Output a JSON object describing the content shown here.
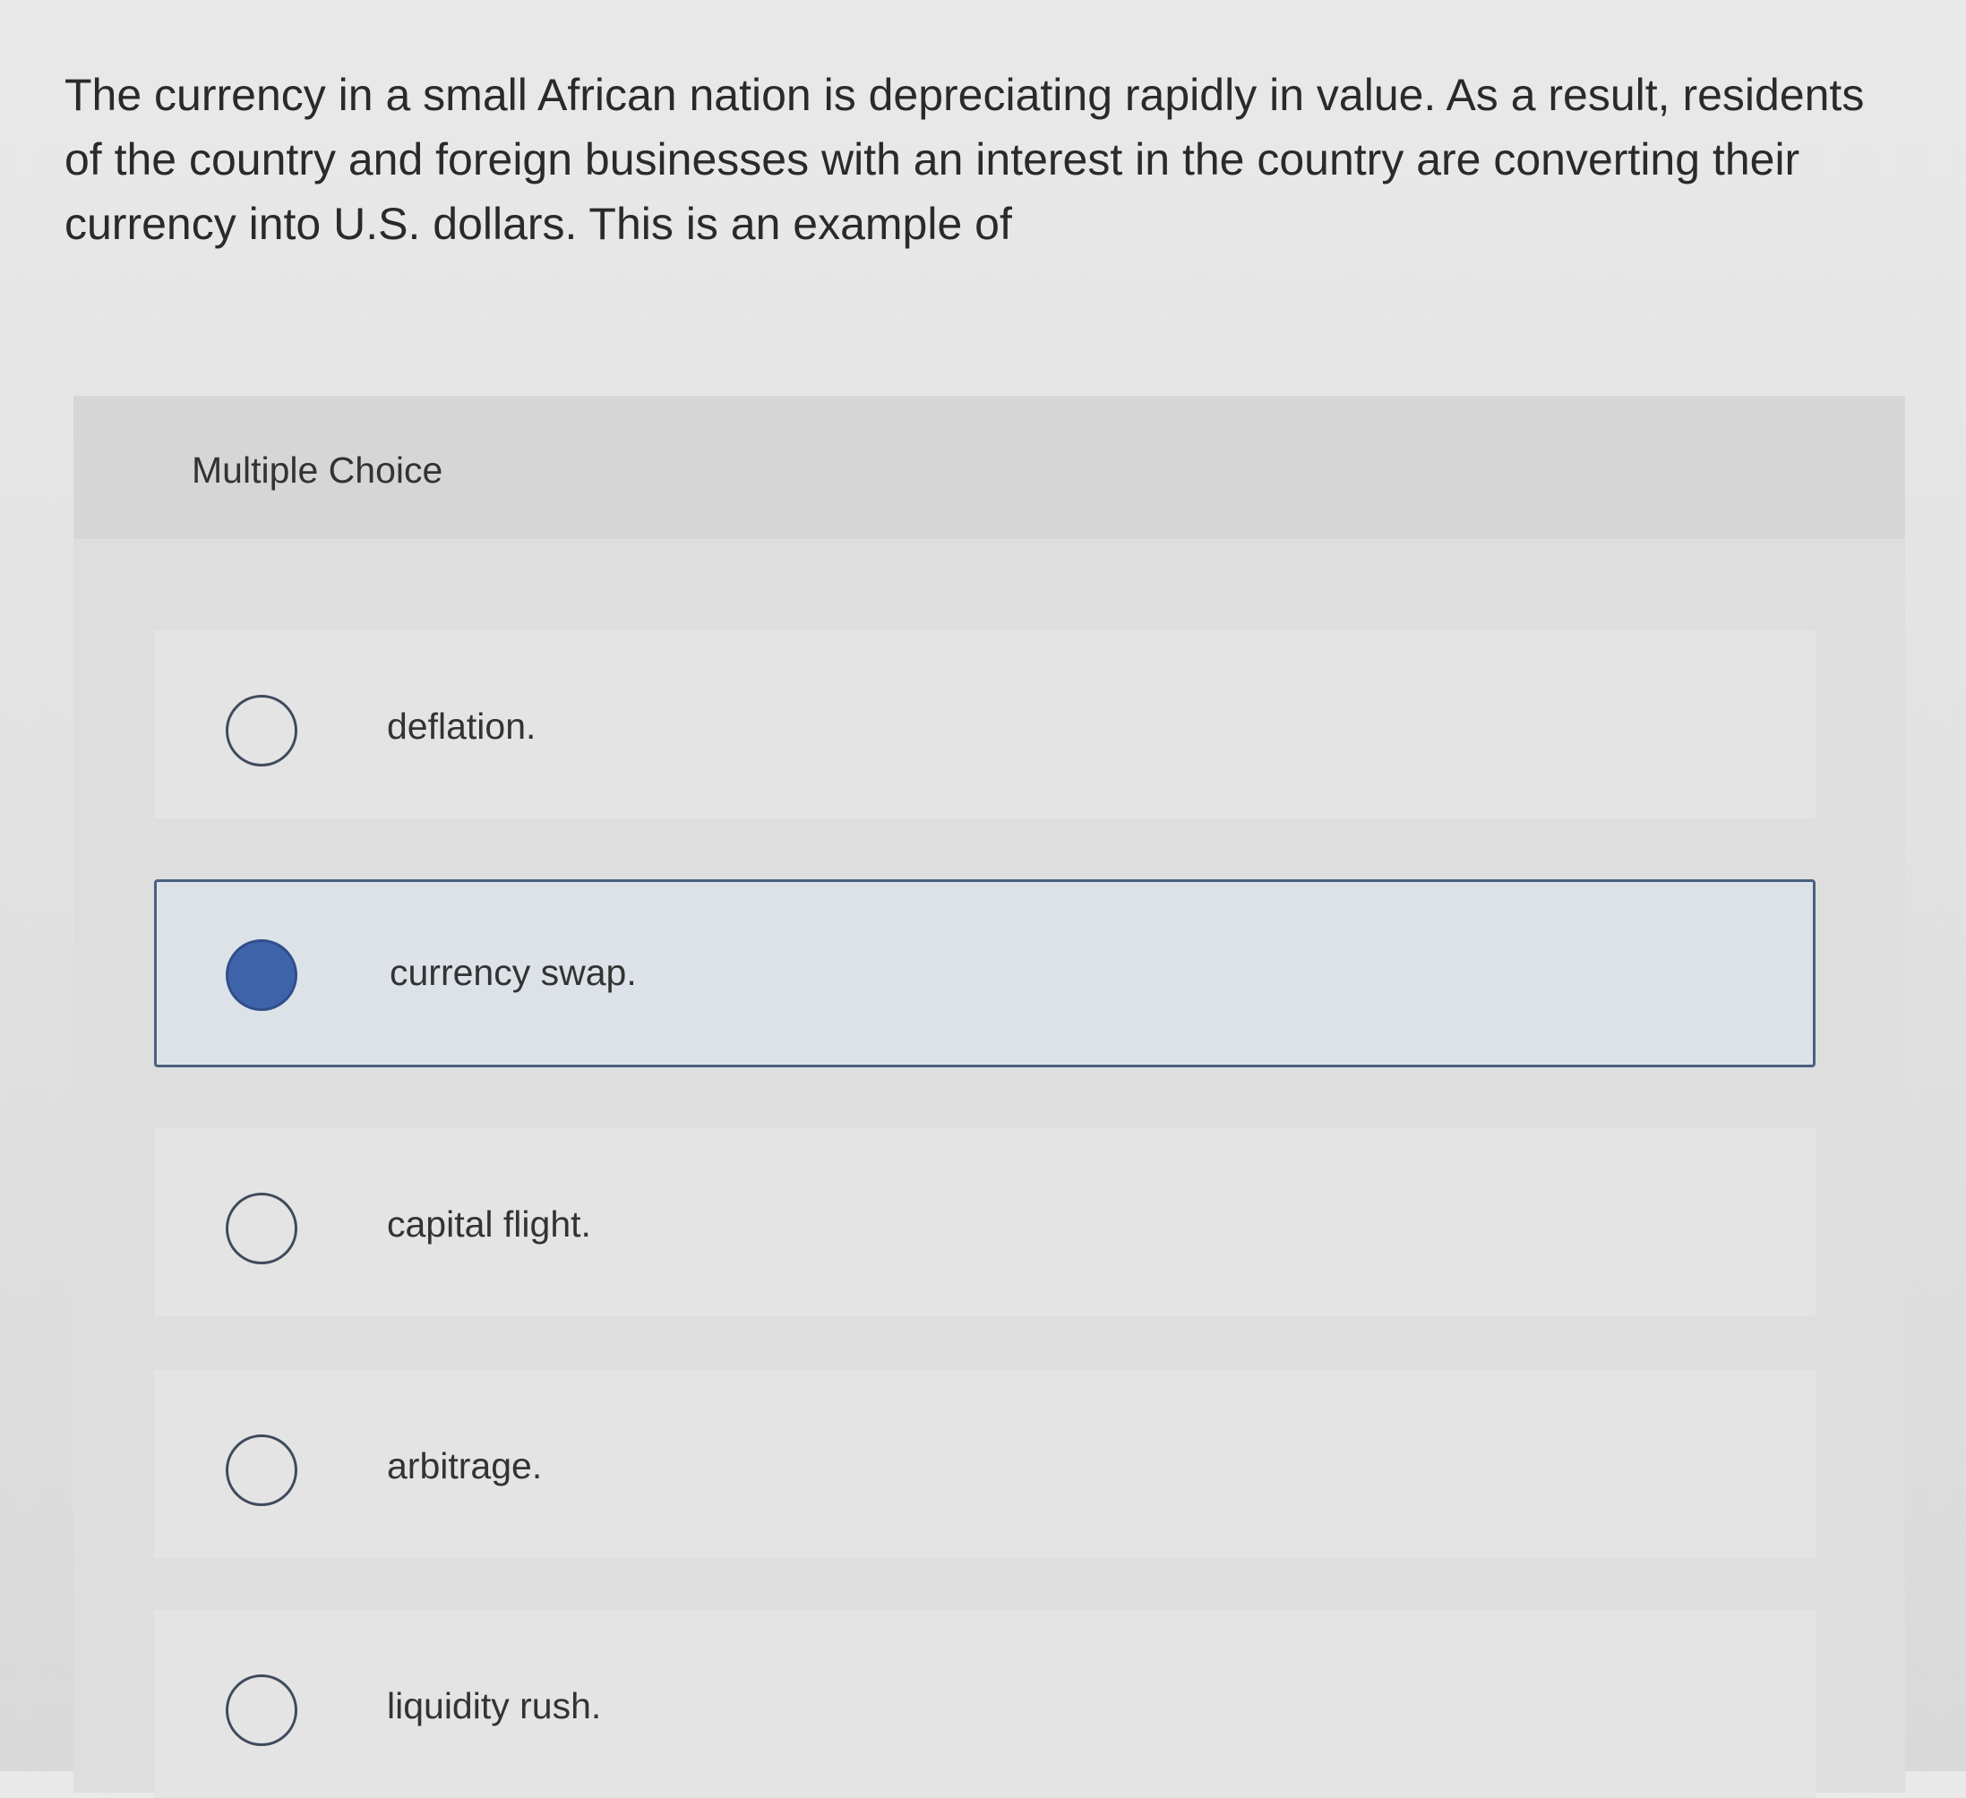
{
  "question": {
    "text": "The currency in a small African nation is depreciating rapidly in value. As a result, residents of the country and foreign businesses with an interest in the country are converting their currency into U.S. dollars. This is an example of"
  },
  "multiple_choice": {
    "title": "Multiple Choice",
    "options": [
      {
        "label": "deflation.",
        "selected": false
      },
      {
        "label": "currency swap.",
        "selected": true
      },
      {
        "label": "capital flight.",
        "selected": false
      },
      {
        "label": "arbitrage.",
        "selected": false
      },
      {
        "label": "liquidity rush.",
        "selected": false
      }
    ]
  },
  "colors": {
    "selected_radio": "#3f63a8",
    "selected_border": "#4a5f80",
    "selected_background": "#dce2e8"
  }
}
